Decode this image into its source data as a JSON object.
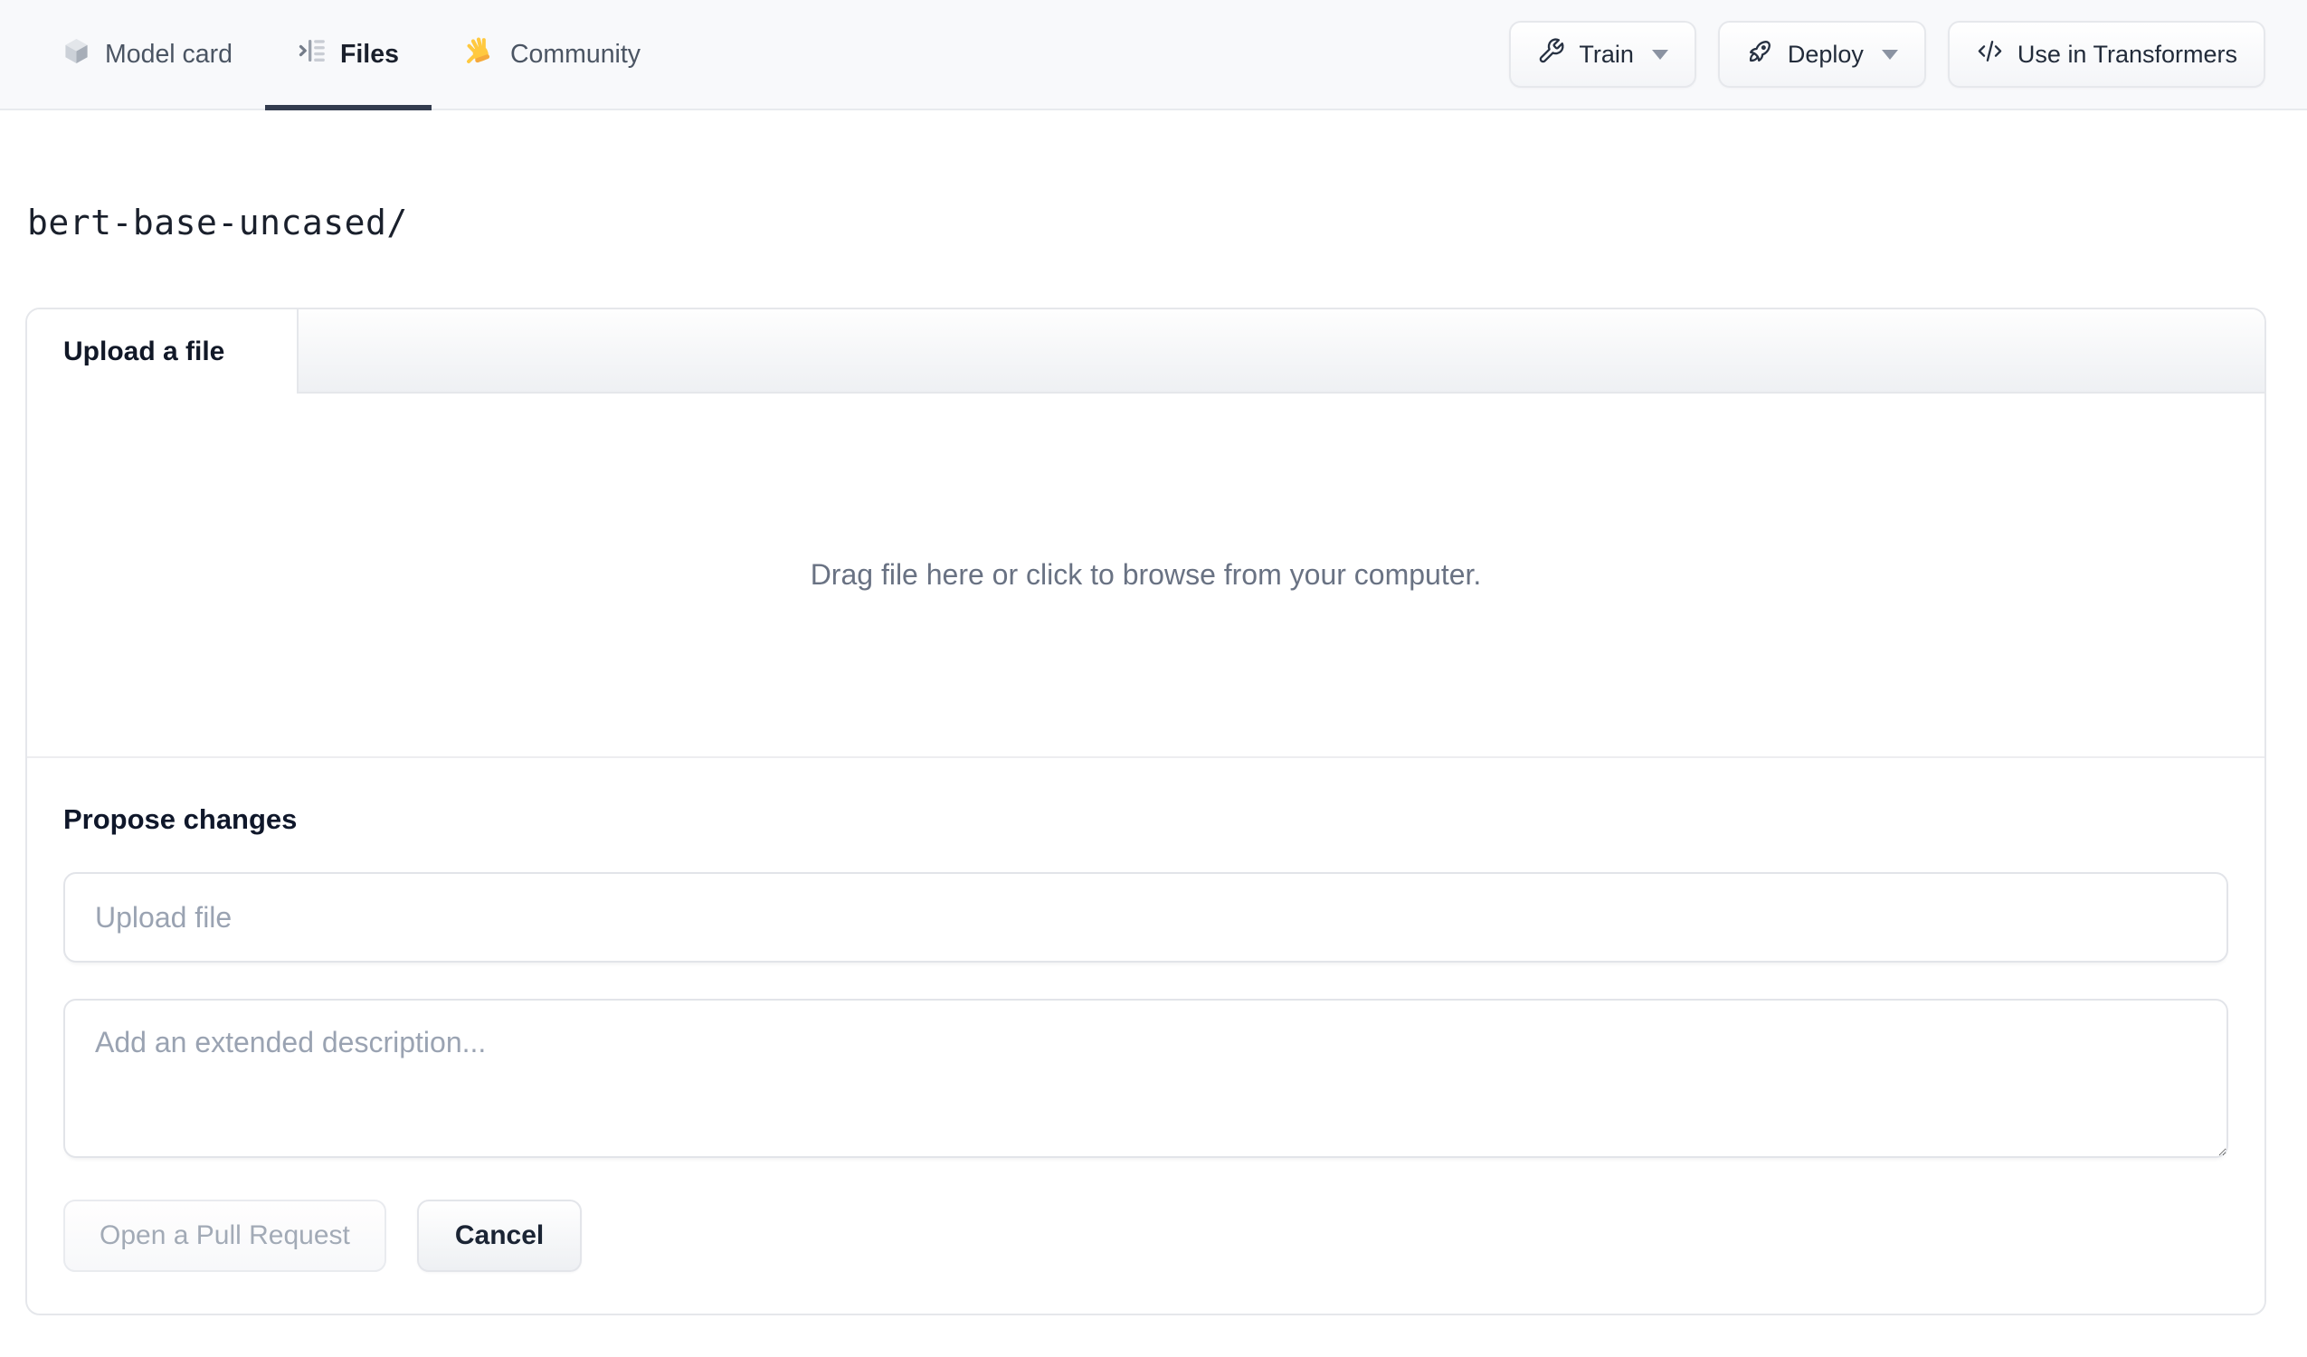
{
  "nav": {
    "tabs": [
      {
        "label": "Model card",
        "icon": "cube-icon",
        "active": false
      },
      {
        "label": "Files",
        "icon": "file-tree-icon",
        "active": true
      },
      {
        "label": "Community",
        "icon": "waving-hand-icon",
        "active": false
      }
    ],
    "actions": {
      "train": {
        "label": "Train",
        "icon": "wrench-icon",
        "has_dropdown": true
      },
      "deploy": {
        "label": "Deploy",
        "icon": "rocket-icon",
        "has_dropdown": true
      },
      "use_in_transformers": {
        "label": "Use in Transformers",
        "icon": "code-icon",
        "has_dropdown": false
      }
    }
  },
  "breadcrumb": {
    "path": "bert-base-uncased/"
  },
  "upload": {
    "tab_label": "Upload a file",
    "dropzone_text": "Drag file here or click to browse from your computer.",
    "propose_heading": "Propose changes",
    "file_input": {
      "value": "",
      "placeholder": "Upload file"
    },
    "description_input": {
      "value": "",
      "placeholder": "Add an extended description..."
    },
    "open_pr_label": "Open a Pull Request",
    "cancel_label": "Cancel"
  },
  "colors": {
    "nav_background": "#f8f9fb",
    "active_tab_underline": "#333c4e",
    "panel_border": "#e5e7eb",
    "muted_text": "#697283",
    "placeholder_text": "#9aa3b2",
    "waving_hand": "#ffc93f",
    "cube_gray": "#ccd1d8"
  }
}
